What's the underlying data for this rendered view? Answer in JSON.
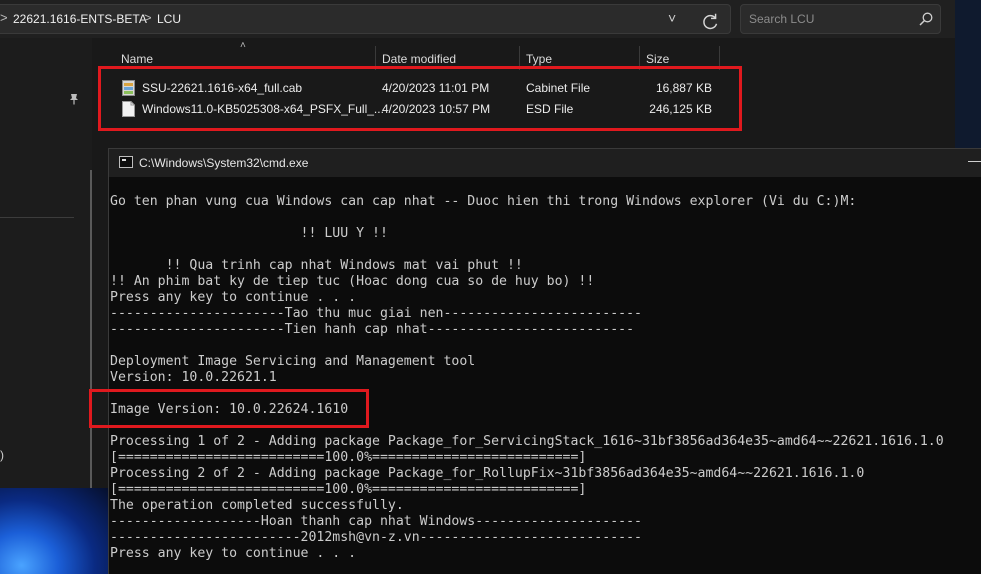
{
  "explorer": {
    "breadcrumb": [
      "22621.1616-ENTS-BETA",
      "LCU"
    ],
    "breadcrumb_separator": ">",
    "search_placeholder": "Search LCU",
    "columns": [
      "Name",
      "Date modified",
      "Type",
      "Size"
    ],
    "nav_partial_text": ")",
    "files": [
      {
        "name": "SSU-22621.1616-x64_full.cab",
        "date": "4/20/2023 11:01 PM",
        "type": "Cabinet File",
        "size": "16,887 KB",
        "icon": "cabinet-file-icon"
      },
      {
        "name": "Windows11.0-KB5025308-x64_PSFX_Full_...",
        "date": "4/20/2023 10:57 PM",
        "type": "ESD File",
        "size": "246,125 KB",
        "icon": "esd-file-icon"
      }
    ]
  },
  "console": {
    "title": "C:\\Windows\\System32\\cmd.exe",
    "lines": [
      "Go ten phan vung cua Windows can cap nhat -- Duoc hien thi trong Windows explorer (Vi du C:)M:",
      "",
      "                        !! LUU Y !!",
      "",
      "       !! Qua trinh cap nhat Windows mat vai phut !!",
      "!! An phim bat ky de tiep tuc (Hoac dong cua so de huy bo) !!",
      "Press any key to continue . . .",
      "----------------------Tao thu muc giai nen-------------------------",
      "----------------------Tien hanh cap nhat--------------------------",
      "",
      "Deployment Image Servicing and Management tool",
      "Version: 10.0.22621.1",
      "",
      "Image Version: 10.0.22624.1610",
      "",
      "Processing 1 of 2 - Adding package Package_for_ServicingStack_1616~31bf3856ad364e35~amd64~~22621.1616.1.0",
      "[==========================100.0%==========================]",
      "Processing 2 of 2 - Adding package Package_for_RollupFix~31bf3856ad364e35~amd64~~22621.1616.1.0",
      "[==========================100.0%==========================]",
      "The operation completed successfully.",
      "-------------------Hoan thanh cap nhat Windows---------------------",
      "------------------------2012msh@vn-z.vn----------------------------",
      "Press any key to continue . . ."
    ]
  },
  "colors": {
    "highlight_box": "#e0191e",
    "console_bg": "#0c0c0c",
    "explorer_bg": "#191919"
  }
}
